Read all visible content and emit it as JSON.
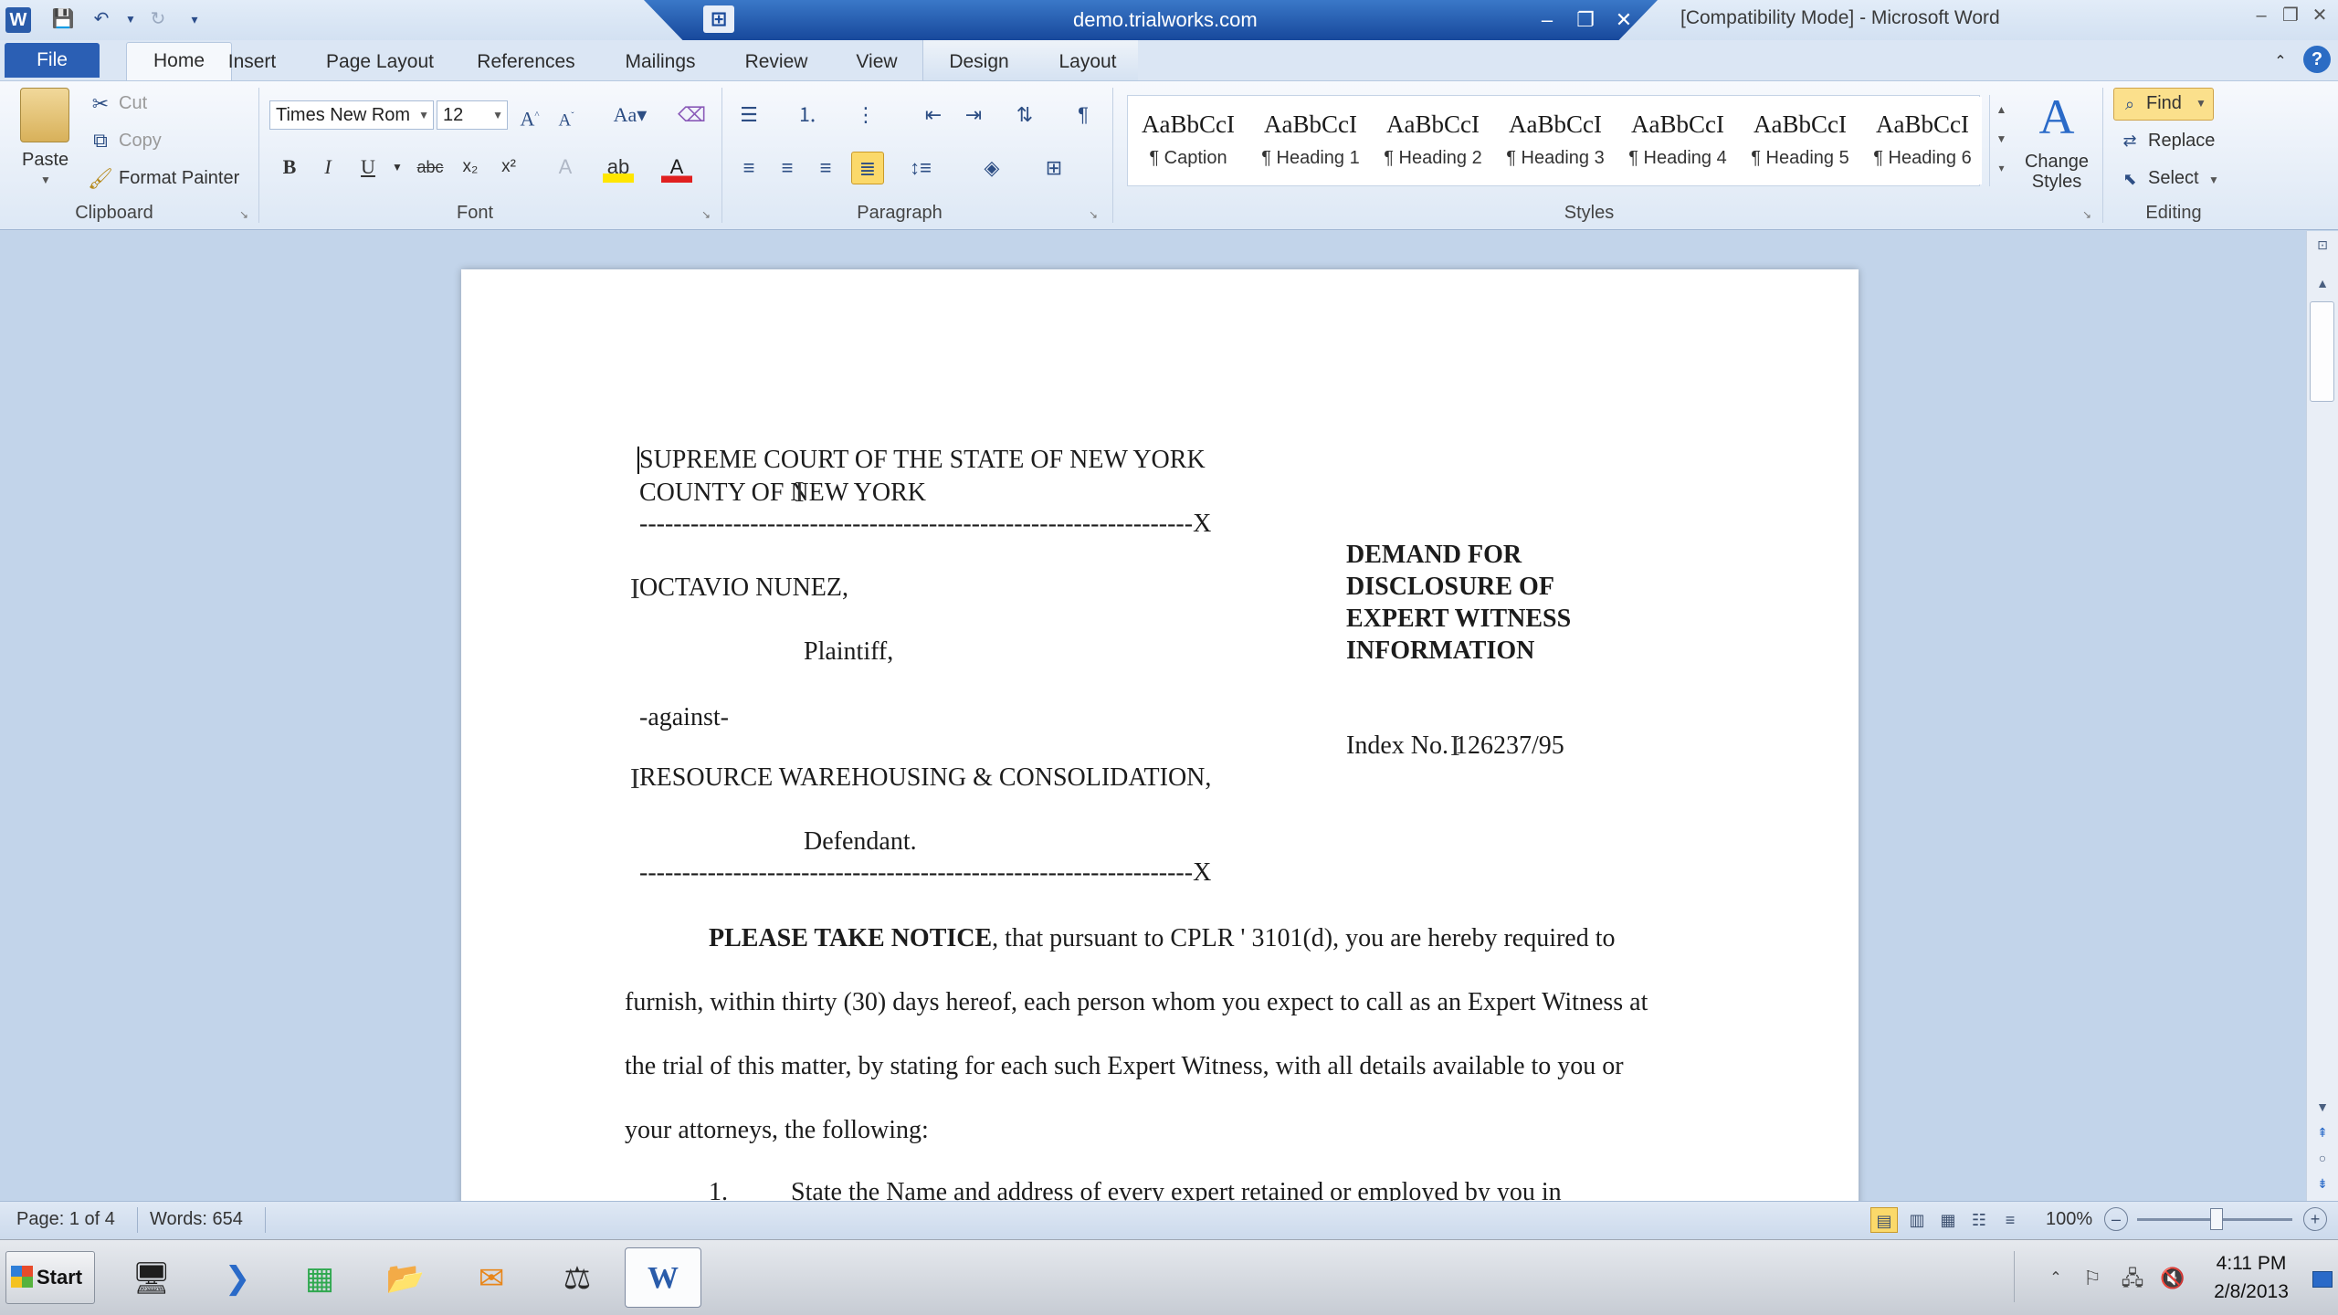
{
  "window": {
    "title": "[Compatibility Mode] - Microsoft Word",
    "remote_host": "demo.trialworks.com"
  },
  "tabs": [
    "File",
    "Home",
    "Insert",
    "Page Layout",
    "References",
    "Mailings",
    "Review",
    "View",
    "Design",
    "Layout"
  ],
  "ribbon": {
    "clipboard": {
      "paste": "Paste",
      "cut": "Cut",
      "copy": "Copy",
      "format_painter": "Format Painter",
      "label": "Clipboard"
    },
    "font": {
      "name": "Times New Rom",
      "size": "12",
      "label": "Font"
    },
    "paragraph": {
      "label": "Paragraph"
    },
    "styles": {
      "label": "Styles",
      "items": [
        {
          "sample": "AaBbCcI",
          "name": "¶ Caption"
        },
        {
          "sample": "AaBbCcI",
          "name": "¶ Heading 1"
        },
        {
          "sample": "AaBbCcI",
          "name": "¶ Heading 2"
        },
        {
          "sample": "AaBbCcI",
          "name": "¶ Heading 3"
        },
        {
          "sample": "AaBbCcI",
          "name": "¶ Heading 4"
        },
        {
          "sample": "AaBbCcI",
          "name": "¶ Heading 5"
        },
        {
          "sample": "AaBbCcI",
          "name": "¶ Heading 6"
        }
      ],
      "change_styles": [
        "Change",
        "Styles"
      ]
    },
    "editing": {
      "find": "Find",
      "replace": "Replace",
      "select": "Select",
      "label": "Editing"
    }
  },
  "document": {
    "court_line1": "SUPREME COURT OF THE STATE OF NEW YORK",
    "court_line2": "COUNTY OF NEW YORK",
    "divider": "-----------------------------------------------------------------X",
    "plaintiff_name": "OCTAVIO NUNEZ,",
    "plaintiff_role": "Plaintiff,",
    "against": "-against-",
    "defendant_name": "RESOURCE WAREHOUSING & CONSOLIDATION,",
    "defendant_role": "Defendant.",
    "doc_title": [
      "DEMAND FOR",
      "DISCLOSURE OF",
      "EXPERT WITNESS",
      "INFORMATION"
    ],
    "index_no": "Index No. 126237/95",
    "notice_bold": "PLEASE TAKE NOTICE",
    "body_line1": ", that pursuant to CPLR ' 3101(d), you are hereby required to",
    "body_line2": "furnish, within thirty (30) days hereof, each person whom you expect to call as an Expert Witness at",
    "body_line3": "the trial of this matter, by stating for each such Expert Witness, with all details available to you or",
    "body_line4": "your attorneys, the following:",
    "item1_num": "1.",
    "item1_text": "State the Name and address of every expert retained or employed by you in"
  },
  "status": {
    "page": "Page: 1 of 4",
    "words": "Words: 654",
    "zoom": "100%"
  },
  "taskbar": {
    "start": "Start",
    "time": "4:11 PM",
    "date": "2/8/2013"
  }
}
